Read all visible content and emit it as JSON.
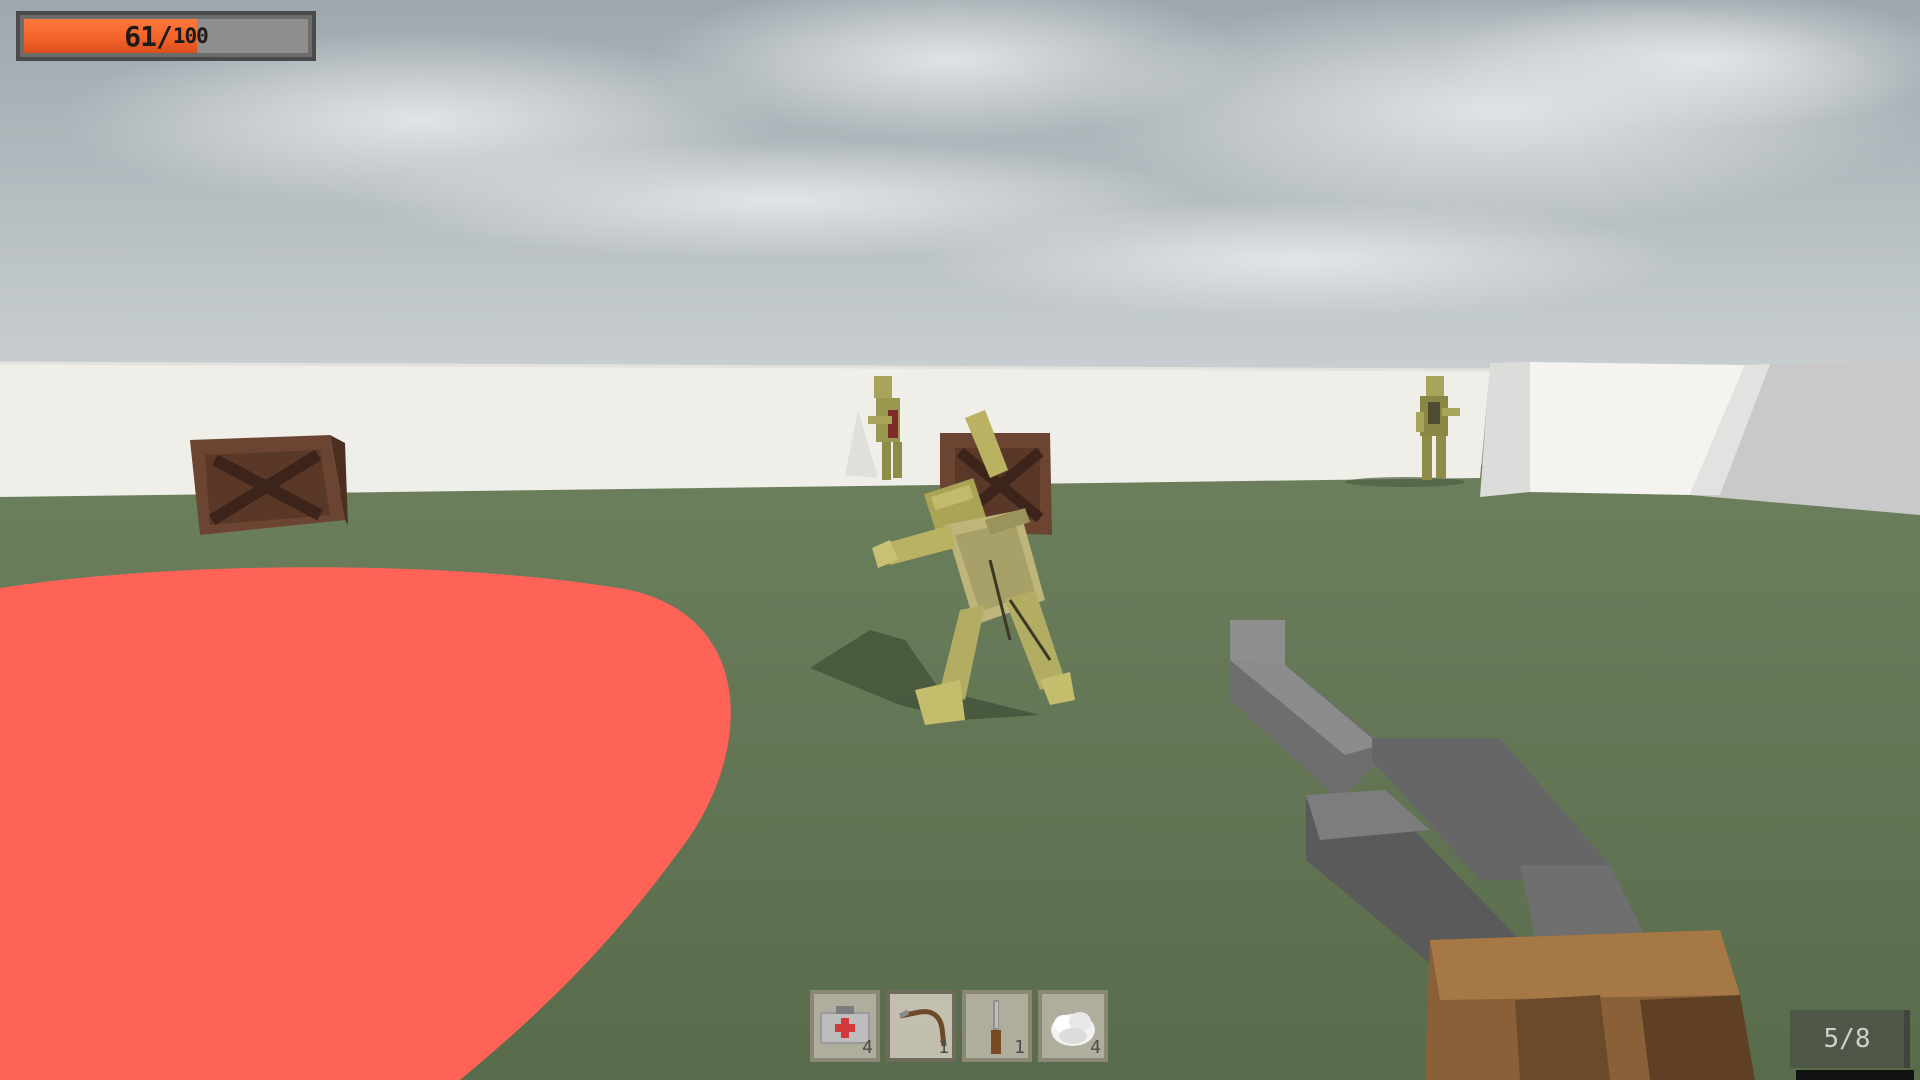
{
  "hud": {
    "health": {
      "current": "61",
      "separator": "/",
      "max": "100",
      "fraction": 0.61,
      "fill_color": "#f26128"
    },
    "hotbar": [
      {
        "item": "medkit-icon",
        "count": "4",
        "selected": false
      },
      {
        "item": "crowbar-icon",
        "count": "1",
        "selected": true
      },
      {
        "item": "knife-icon",
        "count": "1",
        "selected": false
      },
      {
        "item": "cloth-icon",
        "count": "4",
        "selected": false
      }
    ],
    "ammo": {
      "label": "5/8"
    }
  },
  "scene": {
    "sky_color": "#b9c0c4",
    "ground_color": "#5e7251",
    "wall_color": "#eeece6",
    "zone_color": "#ff6358",
    "crate_color": "#6b4432",
    "zombie_color": "#b9b262",
    "gun_color": "#7d7d7d",
    "gun_stock_color": "#8a6038"
  }
}
